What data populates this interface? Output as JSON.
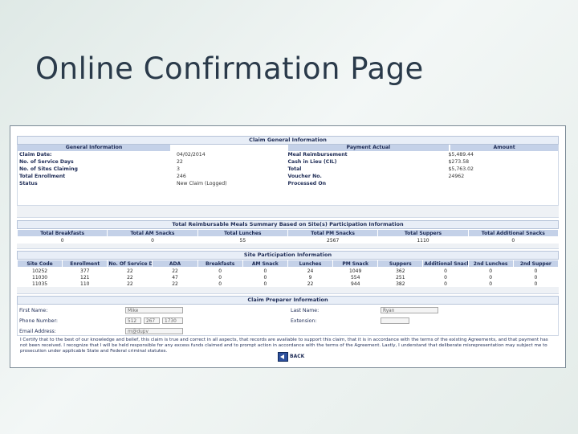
{
  "slide": {
    "title": "Online Confirmation Page"
  },
  "claim_general": {
    "section_title": "Claim General Information",
    "general_header": "General Information",
    "payment_header": "Payment Actual",
    "amount_header": "Amount",
    "left_rows": [
      {
        "label": "Claim Date:",
        "value": "04/02/2014"
      },
      {
        "label": "No. of Service Days",
        "value": "22"
      },
      {
        "label": "No. of Sites Claiming",
        "value": "3"
      },
      {
        "label": "Total Enrollment",
        "value": "246"
      },
      {
        "label": "Status",
        "value": "New Claim (Logged)"
      }
    ],
    "right_rows": [
      {
        "label": "Meal Reimbursement",
        "value": "$5,489.44"
      },
      {
        "label": "Cash in Lieu (CIL)",
        "value": "$273.58"
      },
      {
        "label": "Total",
        "value": "$5,763.02"
      },
      {
        "label": "Voucher No.",
        "value": "24962"
      },
      {
        "label": "Processed On",
        "value": ""
      }
    ]
  },
  "meals_summary": {
    "section_title": "Total Reimbursable Meals Summary Based on Site(s) Participation Information",
    "headers": [
      "Total Breakfasts",
      "Total AM Snacks",
      "Total Lunches",
      "Total PM Snacks",
      "Total Suppers",
      "Total Additional Snacks"
    ],
    "values": [
      "0",
      "0",
      "55",
      "2567",
      "1110",
      "0"
    ]
  },
  "site_participation": {
    "section_title": "Site Participation Information",
    "headers": [
      "Site Code",
      "Enrollment",
      "No. Of Service Days",
      "ADA",
      "Breakfasts",
      "AM Snack",
      "Lunches",
      "PM Snack",
      "Suppers",
      "Additional Snack",
      "2nd Lunches",
      "2nd Supper"
    ],
    "rows": [
      [
        "10252",
        "377",
        "22",
        "22",
        "0",
        "0",
        "24",
        "1049",
        "362",
        "0",
        "0",
        "0"
      ],
      [
        "11030",
        "121",
        "22",
        "47",
        "0",
        "0",
        "9",
        "554",
        "251",
        "0",
        "0",
        "0"
      ],
      [
        "11035",
        "110",
        "22",
        "22",
        "0",
        "0",
        "22",
        "944",
        "382",
        "0",
        "0",
        "0"
      ]
    ]
  },
  "preparer": {
    "section_title": "Claim Preparer Information",
    "first_name_label": "First Name:",
    "first_name_value": "Mike",
    "last_name_label": "Last Name:",
    "last_name_value": "Ryan",
    "phone_label": "Phone Number:",
    "phone_area": "512",
    "phone_prefix": "267",
    "phone_line": "1730",
    "extension_label": "Extension:",
    "extension_value": "",
    "email_label": "Email Address:",
    "email_value": "m@dupv"
  },
  "certification": {
    "text": "I Certify that to the best of our knowledge and belief, this claim is true and correct in all aspects, that records are available to support this claim, that it is in accordance with the terms of the existing Agreements, and that payment has not been received. I recognize that I will be held responsible for any excess funds claimed and to prompt action in accordance with the terms of the Agreement. Lastly, I understand that deliberate misrepresentation may subject me to prosecution under applicable State and Federal criminal statutes."
  },
  "actions": {
    "back_label": "BACK"
  }
}
